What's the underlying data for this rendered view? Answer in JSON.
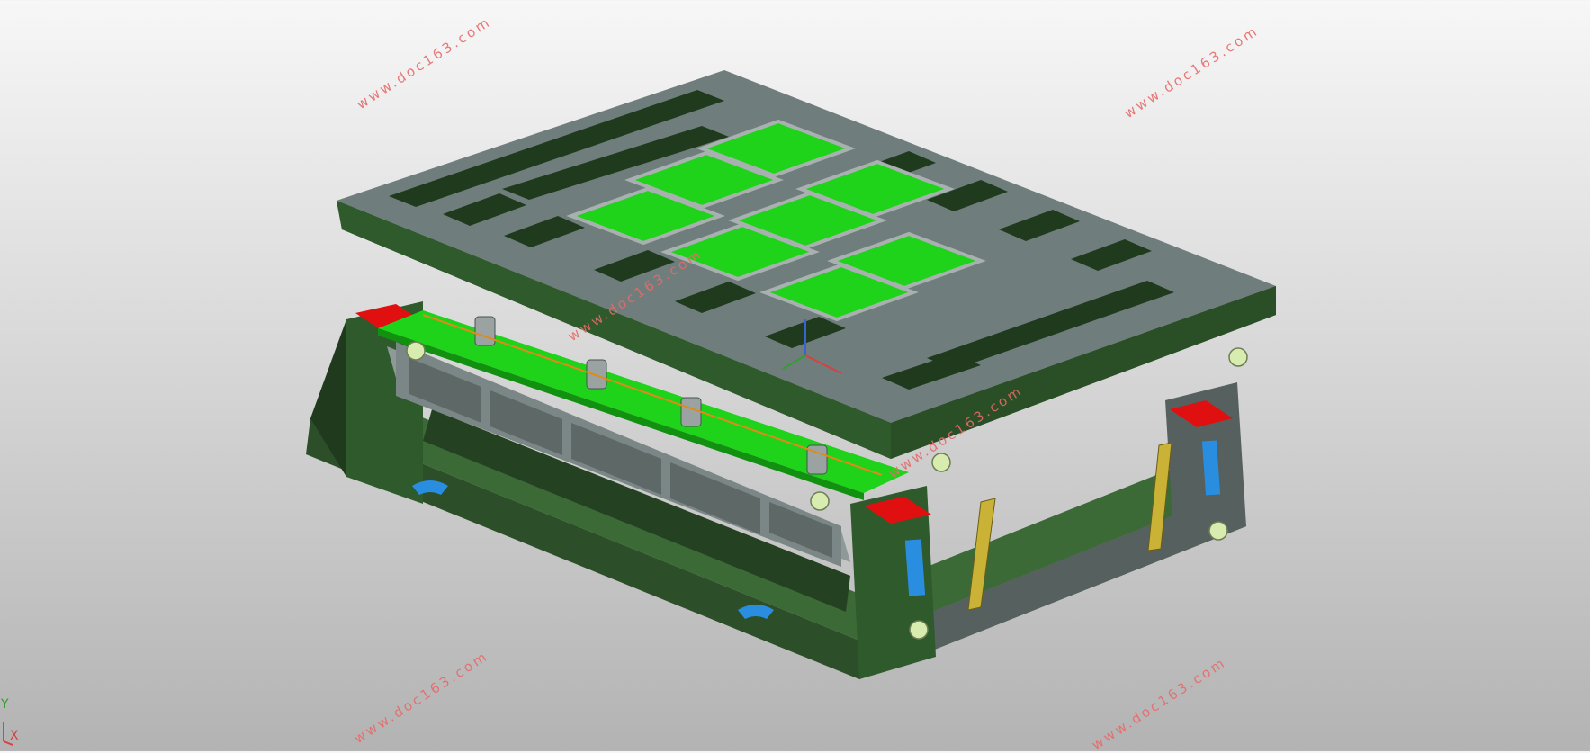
{
  "viewport": {
    "model_colors": {
      "dark_green": "#2f5a2c",
      "deep_green": "#1f3a1d",
      "bright_green": "#1fd21a",
      "steel_gray": "#6f7e7c",
      "light_gray": "#a9b1b0",
      "red_block": "#e01010",
      "blue_slot": "#2a8ee0",
      "yellow_strap": "#c9b236",
      "pale_green_bolt": "#d8ecb0"
    },
    "icons": [
      "triad-axis-icon",
      "view-origin-icon"
    ]
  },
  "watermark": {
    "text": "www.doc163.com",
    "color": "#e86a6a"
  },
  "axis_triad": {
    "y_label": "Y",
    "x_label": "X"
  }
}
